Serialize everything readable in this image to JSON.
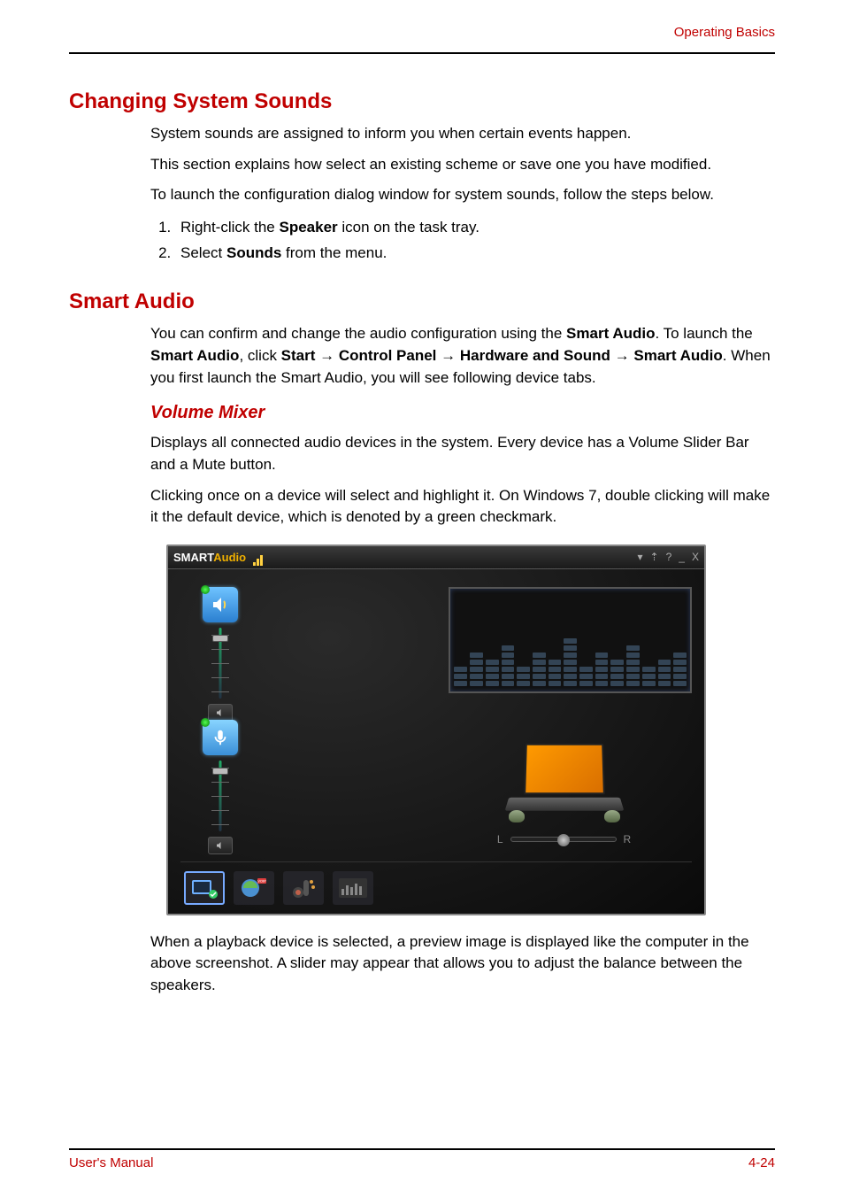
{
  "header": {
    "section_label": "Operating Basics"
  },
  "sec1": {
    "title": "Changing System Sounds",
    "p1": "System sounds are assigned to inform you when certain events happen.",
    "p2": "This section explains how select an existing scheme or save one you have modified.",
    "p3": "To launch the configuration dialog window for system sounds, follow the steps below.",
    "step1_a": "Right-click the ",
    "step1_b": "Speaker",
    "step1_c": " icon on the task tray.",
    "step2_a": "Select ",
    "step2_b": "Sounds",
    "step2_c": " from the menu."
  },
  "sec2": {
    "title": "Smart Audio",
    "p1_a": "You can confirm and change the audio configuration using the ",
    "p1_b": "Smart Audio",
    "p1_c": ". To launch the ",
    "p1_d": "Smart Audio",
    "p1_e": ", click ",
    "p1_f": "Start",
    "p1_g": "Control Panel",
    "p1_h": "Hardware and Sound",
    "p1_i": "Smart Audio",
    "p1_j": ". When you first launch the Smart Audio, you will see following device tabs."
  },
  "sub1": {
    "title": "Volume Mixer",
    "p1": "Displays all connected audio devices in the system. Every device has a Volume Slider Bar and a Mute button.",
    "p2": "Clicking once on a device will select and highlight it. On Windows 7, double clicking will make it the default device, which is denoted by a green checkmark.",
    "p3": "When a playback device is selected, a preview image is displayed like the computer in the above screenshot. A slider may appear that allows you to adjust the balance between the speakers."
  },
  "smartaudio": {
    "title_part1": "SMART",
    "title_part2": "Audio",
    "balance_left": "L",
    "balance_right": "R",
    "win_menu": "▾",
    "win_pin": "⇡",
    "win_help": "?",
    "win_min": "_",
    "win_close": "X"
  },
  "footer": {
    "left": "User's Manual",
    "right": "4-24"
  },
  "arrow": "→"
}
